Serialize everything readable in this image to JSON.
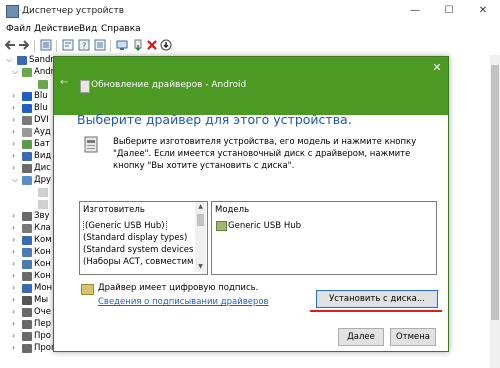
{
  "window": {
    "title": "Диспетчер устройств",
    "minimize_glyph": "—",
    "maximize_glyph": "☐",
    "close_glyph": "✕"
  },
  "menu": [
    "Файл",
    "Действие",
    "Вид",
    "Справка"
  ],
  "tree": {
    "root_label": "Sandro",
    "items": [
      {
        "label": "Andr",
        "color": "#6aa84f"
      },
      {
        "label": "",
        "color": "#6aa84f"
      },
      {
        "label": "Blu",
        "color": "#1f5fbf"
      },
      {
        "label": "Blu",
        "color": "#1f5fbf"
      },
      {
        "label": "DVI",
        "color": "#7a7a7a"
      },
      {
        "label": "Ауд",
        "color": "#9a9a9a"
      },
      {
        "label": "Бат",
        "color": "#5a9a4a"
      },
      {
        "label": "Вид",
        "color": "#3b6ab0"
      },
      {
        "label": "Дис",
        "color": "#6a6a6a"
      },
      {
        "label": "Дру",
        "color": "#5a8fc4"
      },
      {
        "label": "",
        "color": "#d0d0d0"
      },
      {
        "label": "",
        "color": "#d0d0d0"
      },
      {
        "label": "Зву",
        "color": "#6a6a6a"
      },
      {
        "label": "Кла",
        "color": "#7a7a7a"
      },
      {
        "label": "Ком",
        "color": "#3b6ab0"
      },
      {
        "label": "Кон",
        "color": "#4a7ab0"
      },
      {
        "label": "Кон",
        "color": "#4a7ab0"
      },
      {
        "label": "Кон",
        "color": "#6a6a6a"
      },
      {
        "label": "Мон",
        "color": "#3b6ab0"
      },
      {
        "label": "Мы",
        "color": "#555555"
      },
      {
        "label": "Оче",
        "color": "#6a6a6a"
      },
      {
        "label": "Пер",
        "color": "#6a6a6a"
      },
      {
        "label": "Про",
        "color": "#6a6a6a"
      },
      {
        "label": "Программные устройства",
        "color": "#6a6a6a"
      }
    ]
  },
  "dialog": {
    "title": "Обновление драйверов - Android",
    "back_glyph": "←",
    "close_glyph": "✕",
    "heading": "Выберите драйвер для этого устройства.",
    "instruction": "Выберите изготовителя устройства, его модель и нажмите кнопку \"Далее\". Если имеется установочный диск с драйвером, нажмите кнопку \"Вы хотите установить с диска\".",
    "manufacturer_header": "Изготовитель",
    "manufacturers": [
      "(Generic USB Hub)",
      "(Standard display types)",
      "(Standard system devices)",
      "(Наборы ACT, совместимые с"
    ],
    "model_header": "Модель",
    "models": [
      "Generic USB Hub"
    ],
    "signature_text": "Драйвер имеет цифровую подпись.",
    "signature_link": "Сведения о подписывании драйверов",
    "install_button": "Установить с диска...",
    "next_button": "Далее",
    "cancel_button": "Отмена",
    "accent_color": "#4c9a23",
    "highlight_color": "#e21b1b"
  }
}
